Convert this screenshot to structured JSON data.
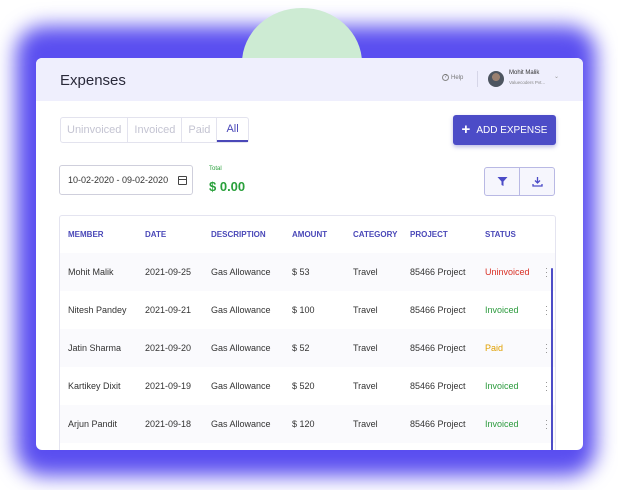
{
  "header": {
    "title": "Expenses",
    "help_label": "Help",
    "user_name": "Mohit Malik",
    "user_company": "Valuecoders Pvt...",
    "chevron": "⌄"
  },
  "tabs": [
    {
      "label": "Uninvoiced",
      "active": false
    },
    {
      "label": "Invoiced",
      "active": false
    },
    {
      "label": "Paid",
      "active": false
    },
    {
      "label": "All",
      "active": true
    }
  ],
  "add_button": {
    "label": "ADD EXPENSE",
    "icon": "plus-icon"
  },
  "date_filter": {
    "value": "10-02-2020 - 09-02-2020",
    "icon": "calendar-icon"
  },
  "total": {
    "label": "Total",
    "value": "$ 0.00"
  },
  "actions": {
    "filter_icon": "filter-icon",
    "download_icon": "download-icon"
  },
  "table": {
    "headers": [
      "MEMBER",
      "DATE",
      "DESCRIPTION",
      "AMOUNT",
      "CATEGORY",
      "PROJECT",
      "STATUS"
    ],
    "rows": [
      {
        "member": "Mohit Malik",
        "date": "2021-09-25",
        "description": "Gas Allowance",
        "amount": "$ 53",
        "category": "Travel",
        "project": "85466 Project",
        "status": "Uninvoiced",
        "status_key": "uninvoiced"
      },
      {
        "member": "Nitesh Pandey",
        "date": "2021-09-21",
        "description": "Gas Allowance",
        "amount": "$ 100",
        "category": "Travel",
        "project": "85466 Project",
        "status": "Invoiced",
        "status_key": "invoiced"
      },
      {
        "member": "Jatin Sharma",
        "date": "2021-09-20",
        "description": "Gas Allowance",
        "amount": "$ 52",
        "category": "Travel",
        "project": "85466 Project",
        "status": "Paid",
        "status_key": "paid"
      },
      {
        "member": "Kartikey Dixit",
        "date": "2021-09-19",
        "description": "Gas Allowance",
        "amount": "$ 520",
        "category": "Travel",
        "project": "85466 Project",
        "status": "Invoiced",
        "status_key": "invoiced"
      },
      {
        "member": "Arjun Pandit",
        "date": "2021-09-18",
        "description": "Gas Allowance",
        "amount": "$ 120",
        "category": "Travel",
        "project": "85466 Project",
        "status": "Invoiced",
        "status_key": "invoiced"
      }
    ]
  },
  "colors": {
    "accent": "#4c4cc7",
    "uninvoiced": "#d93025",
    "invoiced": "#2a9a3c",
    "paid": "#e0a000",
    "total": "#2aa03c"
  }
}
